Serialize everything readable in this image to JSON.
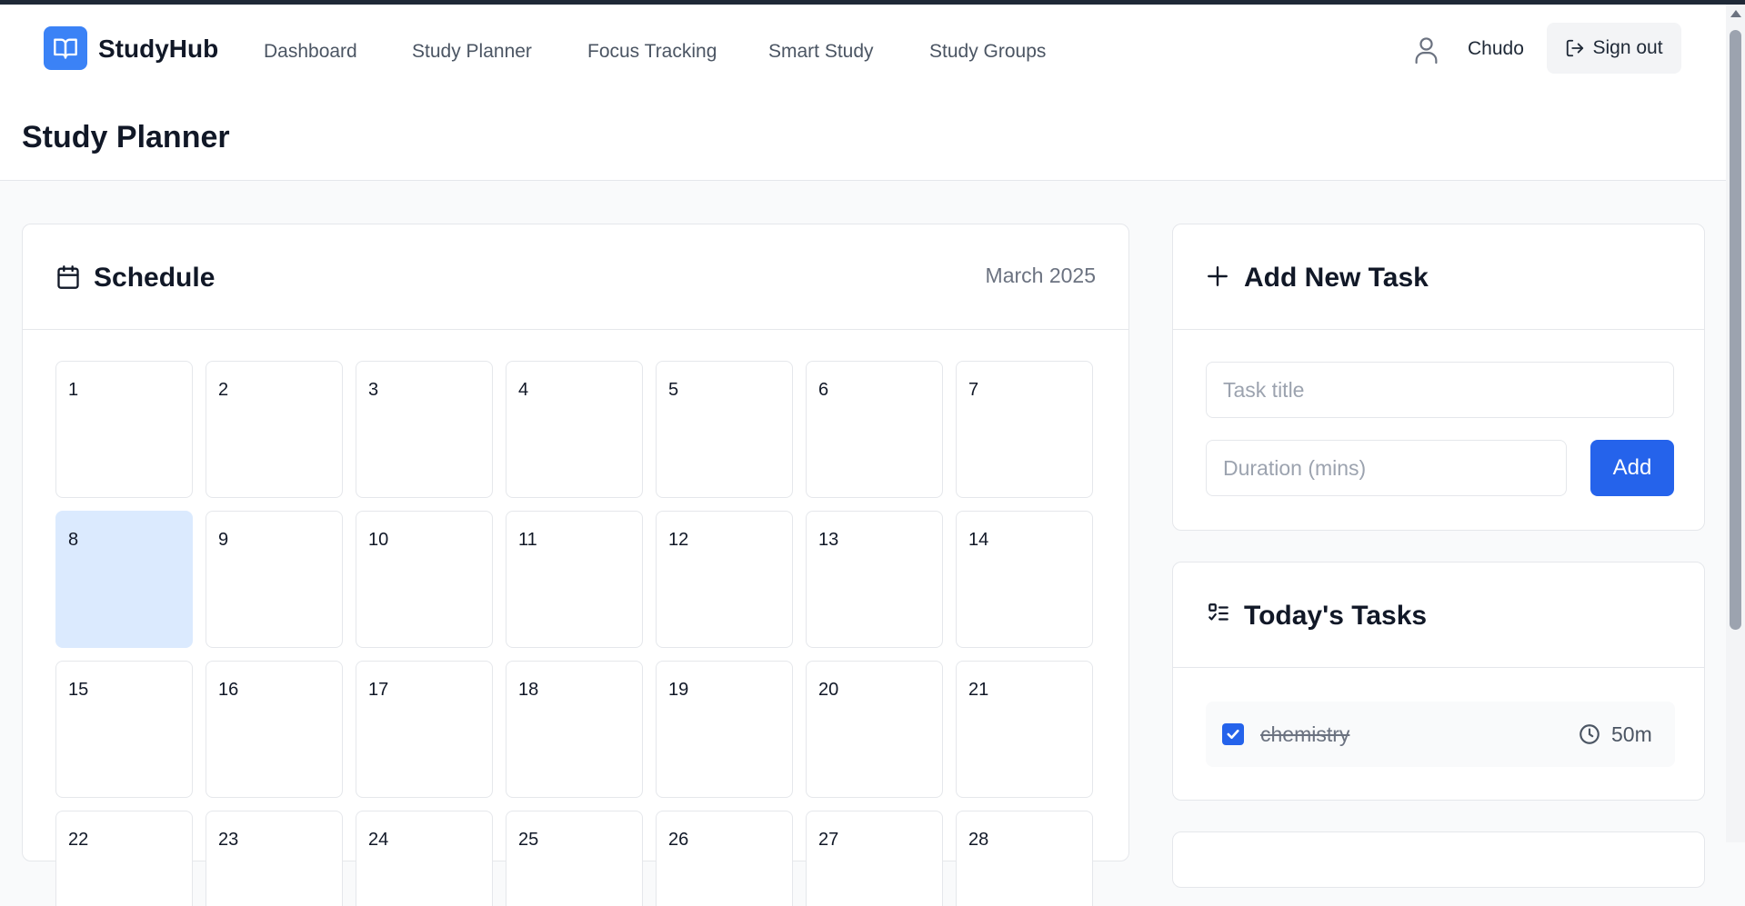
{
  "header": {
    "brand": "StudyHub",
    "nav": [
      "Dashboard",
      "Study Planner",
      "Focus Tracking",
      "Smart Study",
      "Study Groups"
    ],
    "user_name": "Chudo",
    "signout_label": "Sign out"
  },
  "page_title": "Study Planner",
  "schedule": {
    "title": "Schedule",
    "month": "March 2025",
    "days": [
      "1",
      "2",
      "3",
      "4",
      "5",
      "6",
      "7",
      "8",
      "9",
      "10",
      "11",
      "12",
      "13",
      "14",
      "15",
      "16",
      "17",
      "18",
      "19",
      "20",
      "21",
      "22",
      "23",
      "24",
      "25",
      "26",
      "27",
      "28"
    ],
    "selected_day": "8"
  },
  "add_task": {
    "title": "Add New Task",
    "title_placeholder": "Task title",
    "duration_placeholder": "Duration (mins)",
    "add_label": "Add"
  },
  "today": {
    "title": "Today's Tasks",
    "tasks": [
      {
        "title": "chemistry",
        "duration": "50m",
        "done": true
      }
    ]
  },
  "colors": {
    "accent": "#2563eb",
    "logo": "#3b82f6",
    "selected_day": "#dbeafe"
  },
  "icons": [
    "book-open-icon",
    "user-icon",
    "sign-out-icon",
    "calendar-icon",
    "plus-icon",
    "list-check-icon",
    "clock-icon",
    "check-icon"
  ]
}
